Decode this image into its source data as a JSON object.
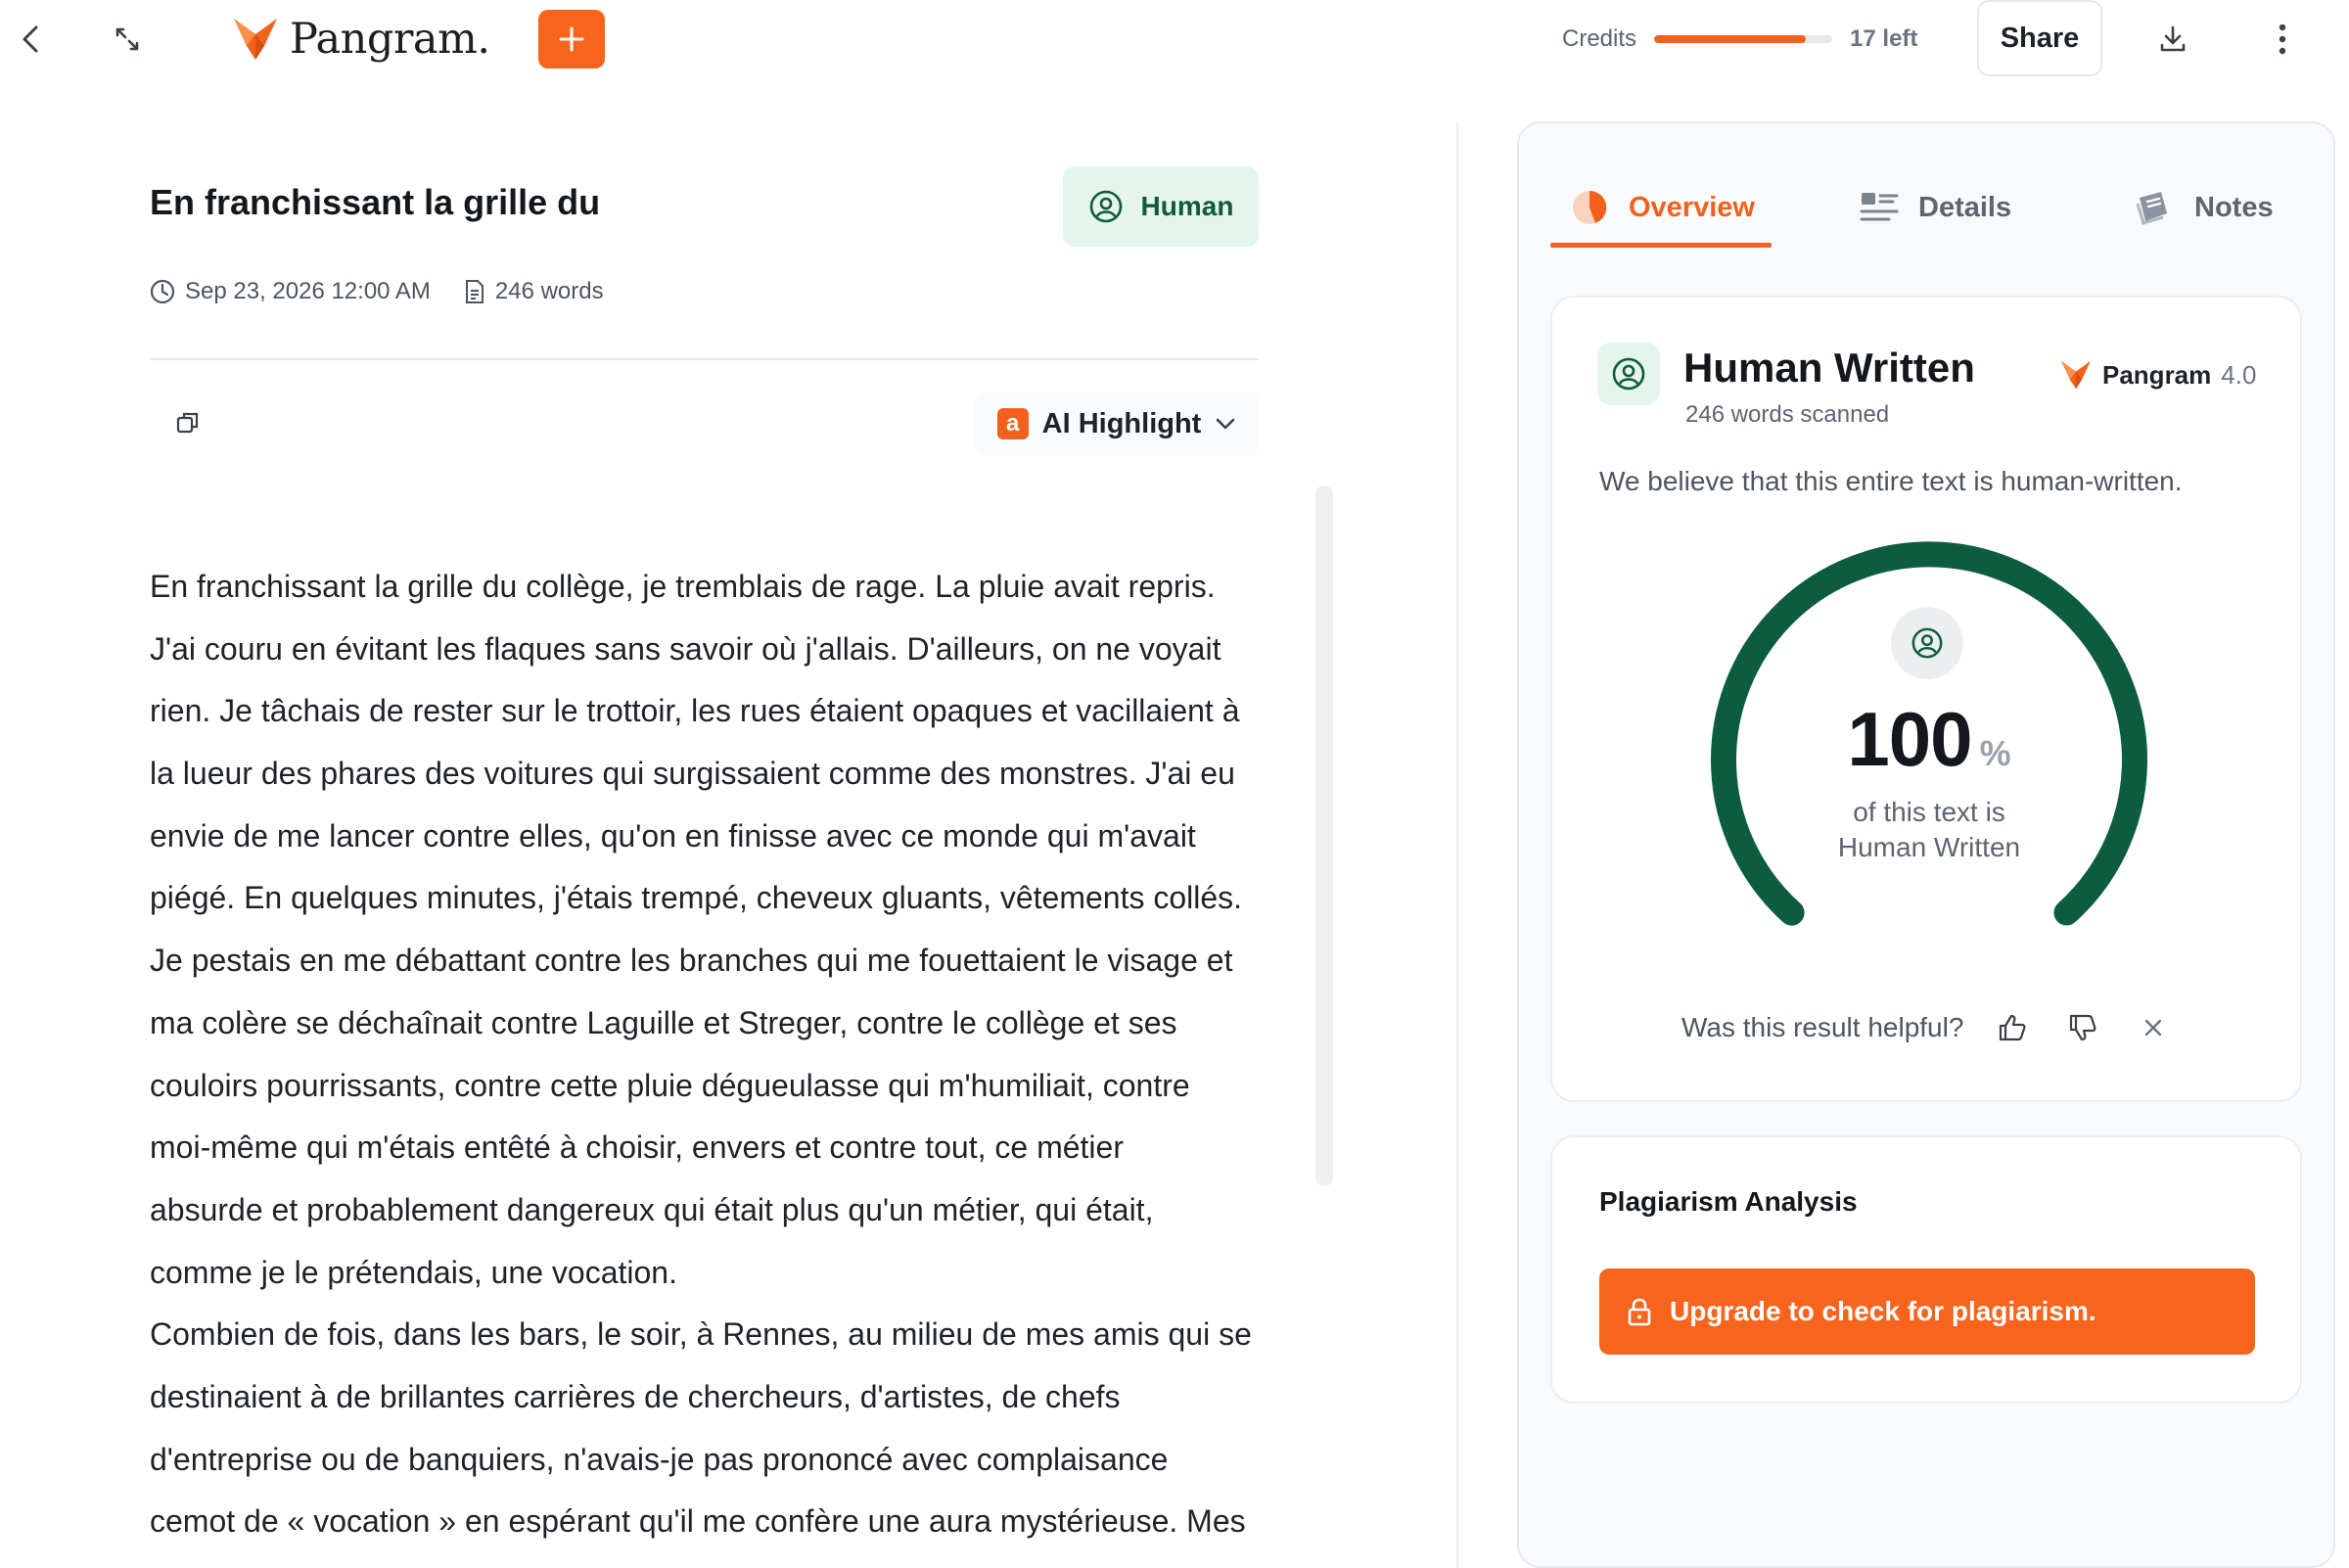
{
  "header": {
    "brand": "Pangram.",
    "credits_label": "Credits",
    "credits_fraction": 0.85,
    "credits_left": "17 left",
    "share_label": "Share",
    "colors": {
      "accent": "#f2611c",
      "human_green": "#0f5a3e"
    }
  },
  "document": {
    "title": "En franchissant la grille du",
    "badge": "Human",
    "date": "Sep 23, 2026 12:00 AM",
    "word_count": "246 words",
    "highlight_mode": "AI Highlight",
    "highlight_badge": "a",
    "lines": [
      "En franchissant la grille du collège, je tremblais de rage. La pluie avait repris.",
      "J'ai couru en évitant les flaques sans savoir où j'allais. D'ailleurs, on ne voyait",
      "rien. Je tâchais de rester sur le trottoir, les rues étaient opaques et vacillaient à",
      "la lueur des phares des voitures qui surgissaient comme des monstres. J'ai eu",
      "envie de me lancer contre elles, qu'on en finisse avec ce monde qui m'avait",
      "piégé. En quelques minutes, j'étais trempé, cheveux gluants, vêtements collés.",
      "Je pestais en me débattant contre les branches qui me fouettaient le visage et",
      "ma colère se déchaînait contre Laguille et Streger, contre le collège et ses",
      "couloirs pourrissants, contre cette pluie dégueulasse qui m'humiliait, contre",
      "moi-même qui m'étais entêté à choisir, envers et contre tout, ce métier",
      "absurde et probablement dangereux qui était plus qu'un métier, qui était,",
      "comme je le prétendais, une vocation.",
      "Combien de fois, dans les bars, le soir, à Rennes, au milieu de mes amis qui se",
      "destinaient à de brillantes carrières de chercheurs, d'artistes, de chefs",
      "d'entreprise ou de banquiers, n'avais-je pas prononcé avec complaisance",
      "cemot de « vocation » en espérant qu'il me confère une aura mystérieuse. Mes"
    ]
  },
  "panel": {
    "tabs": [
      {
        "label": "Overview",
        "icon": "pie-chart-icon",
        "active": true
      },
      {
        "label": "Details",
        "icon": "list-icon",
        "active": false
      },
      {
        "label": "Notes",
        "icon": "note-icon",
        "active": false
      }
    ],
    "result": {
      "title": "Human Written",
      "subtitle": "246 words scanned",
      "model_name": "Pangram",
      "model_version": "4.0",
      "belief": "We believe that this entire text is human-written.",
      "percent": "100",
      "percent_value": 100,
      "percent_sign": "%",
      "caption_line1": "of this text is",
      "caption_line2": "Human Written",
      "helpful_prompt": "Was this result helpful?"
    },
    "plagiarism": {
      "title": "Plagiarism Analysis",
      "upgrade_label": "Upgrade to check for plagiarism."
    }
  }
}
